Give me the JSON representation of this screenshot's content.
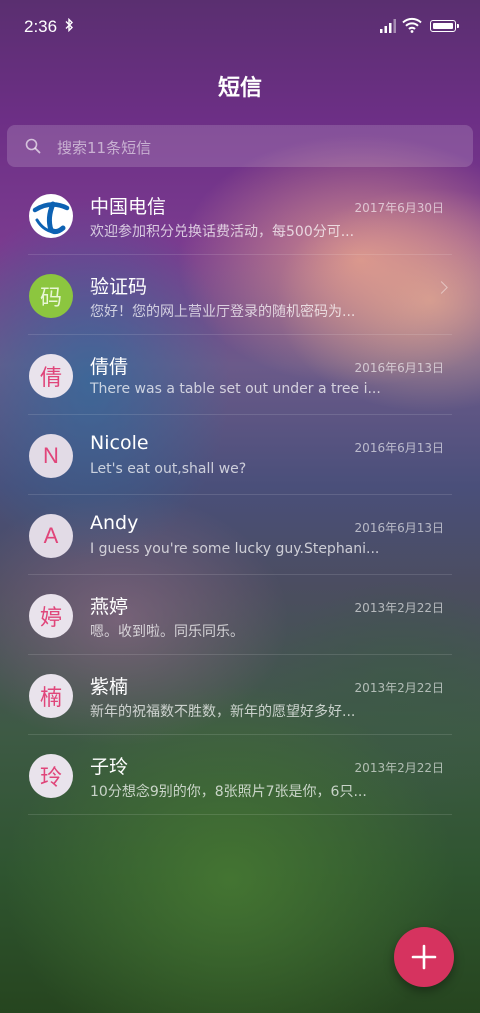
{
  "status_bar": {
    "time": "2:36"
  },
  "header": {
    "title": "短信"
  },
  "search": {
    "placeholder": "搜索11条短信"
  },
  "conversations": [
    {
      "avatar": "",
      "avatar_type": "telecom-logo",
      "name": "中国电信",
      "date": "2017年6月30日",
      "preview": "欢迎参加积分兑换话费活动，每500分可..."
    },
    {
      "avatar": "码",
      "avatar_type": "green",
      "name": "验证码",
      "date": "",
      "preview": "您好！您的网上营业厅登录的随机密码为..."
    },
    {
      "avatar": "倩",
      "avatar_type": "char",
      "name": "倩倩",
      "date": "2016年6月13日",
      "preview": "There was a table set out under a tree i..."
    },
    {
      "avatar": "N",
      "avatar_type": "letter",
      "name": "Nicole",
      "date": "2016年6月13日",
      "preview": "Let's eat out,shall we?"
    },
    {
      "avatar": "A",
      "avatar_type": "letter",
      "name": "Andy",
      "date": "2016年6月13日",
      "preview": "I guess you're some lucky guy.Stephani..."
    },
    {
      "avatar": "婷",
      "avatar_type": "char",
      "name": "燕婷",
      "date": "2013年2月22日",
      "preview": "嗯。收到啦。同乐同乐。"
    },
    {
      "avatar": "楠",
      "avatar_type": "char",
      "name": "紫楠",
      "date": "2013年2月22日",
      "preview": "新年的祝福数不胜数，新年的愿望好多好..."
    },
    {
      "avatar": "玲",
      "avatar_type": "char",
      "name": "子玲",
      "date": "2013年2月22日",
      "preview": "10分想念9别的你，8张照片7张是你，6只..."
    }
  ],
  "colors": {
    "accent": "#d6335f",
    "avatar_text": "#e0457a",
    "verify_avatar": "#8cc63f"
  },
  "icons": {
    "fab": "plus-icon",
    "search": "search-icon"
  }
}
